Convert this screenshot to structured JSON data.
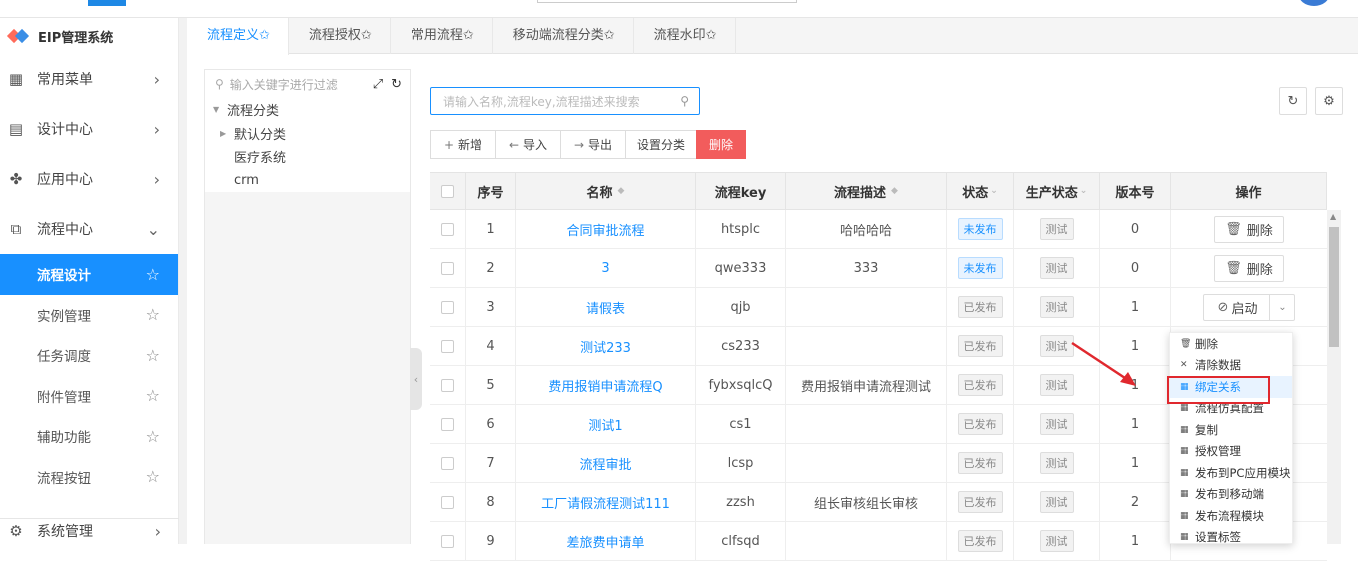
{
  "brand": {
    "title": "EIP管理系统"
  },
  "sidebar": {
    "menus": [
      {
        "label": "常用菜单",
        "icon": "grid-icon"
      },
      {
        "label": "设计中心",
        "icon": "design-icon"
      },
      {
        "label": "应用中心",
        "icon": "apps-icon"
      },
      {
        "label": "流程中心",
        "icon": "flow-icon"
      }
    ],
    "sub": [
      {
        "label": "流程设计"
      },
      {
        "label": "实例管理"
      },
      {
        "label": "任务调度"
      },
      {
        "label": "附件管理"
      },
      {
        "label": "辅助功能"
      },
      {
        "label": "流程按钮"
      }
    ],
    "bottom": {
      "label": "系统管理"
    }
  },
  "tabs": [
    "流程定义✩",
    "流程授权✩",
    "常用流程✩",
    "移动端流程分类✩",
    "流程水印✩"
  ],
  "tree": {
    "filter_placeholder": "输入关键字进行过滤",
    "nodes": [
      "流程分类",
      "默认分类",
      "医疗系统",
      "crm"
    ]
  },
  "search": {
    "placeholder": "请输入名称,流程key,流程描述来搜索"
  },
  "toolbar": {
    "add": "新增",
    "import": "导入",
    "export": "导出",
    "set_category": "设置分类",
    "delete": "删除"
  },
  "table": {
    "headers": [
      "序号",
      "名称",
      "流程key",
      "流程描述",
      "状态",
      "生产状态",
      "版本号",
      "操作"
    ],
    "rows": [
      {
        "no": "1",
        "name": "合同审批流程",
        "key": "htsplc",
        "desc": "哈哈哈哈",
        "status": "未发布",
        "prod": "测试",
        "ver": "0",
        "op": "删除"
      },
      {
        "no": "2",
        "name": "3",
        "key": "qwe333",
        "desc": "333",
        "status": "未发布",
        "prod": "测试",
        "ver": "0",
        "op": "删除"
      },
      {
        "no": "3",
        "name": "请假表",
        "key": "qjb",
        "desc": "",
        "status": "已发布",
        "prod": "测试",
        "ver": "1",
        "op": "启动"
      },
      {
        "no": "4",
        "name": "测试233",
        "key": "cs233",
        "desc": "",
        "status": "已发布",
        "prod": "测试",
        "ver": "1",
        "op": ""
      },
      {
        "no": "5",
        "name": "费用报销申请流程Q",
        "key": "fybxsqlcQ",
        "desc": "费用报销申请流程测试",
        "status": "已发布",
        "prod": "测试",
        "ver": "1",
        "op": ""
      },
      {
        "no": "6",
        "name": "测试1",
        "key": "cs1",
        "desc": "",
        "status": "已发布",
        "prod": "测试",
        "ver": "1",
        "op": ""
      },
      {
        "no": "7",
        "name": "流程审批",
        "key": "lcsp",
        "desc": "",
        "status": "已发布",
        "prod": "测试",
        "ver": "1",
        "op": ""
      },
      {
        "no": "8",
        "name": "工厂请假流程测试111",
        "key": "zzsh",
        "desc": "组长审核组长审核",
        "status": "已发布",
        "prod": "测试",
        "ver": "2",
        "op": ""
      },
      {
        "no": "9",
        "name": "差旅费申请单",
        "key": "clfsqd",
        "desc": "",
        "status": "已发布",
        "prod": "测试",
        "ver": "1",
        "op": ""
      }
    ]
  },
  "dropdown": [
    "删除",
    "清除数据",
    "绑定关系",
    "流程仿真配置",
    "复制",
    "授权管理",
    "发布到PC应用模块",
    "发布到移动端",
    "发布流程模块",
    "设置标签"
  ],
  "colors": {
    "primary": "#1890ff",
    "danger": "#f25c5c",
    "highlight": "#e0282e"
  }
}
